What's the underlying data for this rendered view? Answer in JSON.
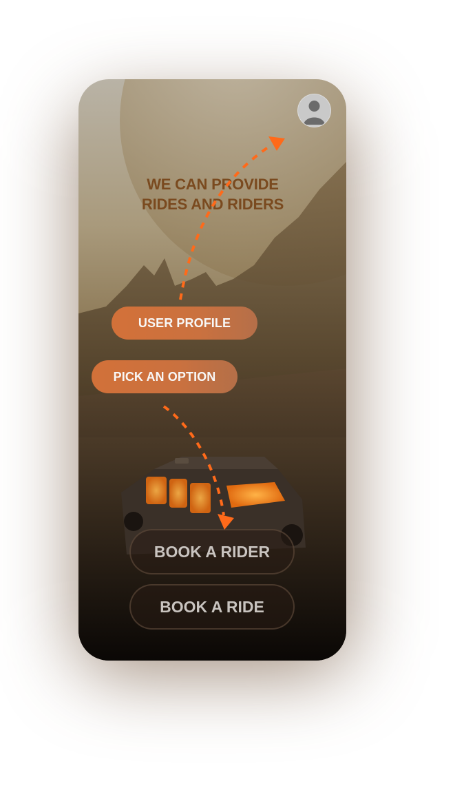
{
  "header": {
    "avatar_icon": "user-avatar-icon"
  },
  "hero": {
    "headline_line1": "WE CAN PROVIDE",
    "headline_line2": "RIDES AND RIDERS"
  },
  "annotations": {
    "user_profile_label": "USER PROFILE",
    "pick_option_label": "PICK AN OPTION",
    "arrow_color": "#ff6a1a"
  },
  "actions": {
    "book_rider_label": "BOOK A RIDER",
    "book_ride_label": "BOOK A RIDE"
  },
  "colors": {
    "accent": "#d8733a",
    "headline": "#7a4a1f",
    "button_bg": "#281c14",
    "button_text": "#c9c4c0"
  }
}
